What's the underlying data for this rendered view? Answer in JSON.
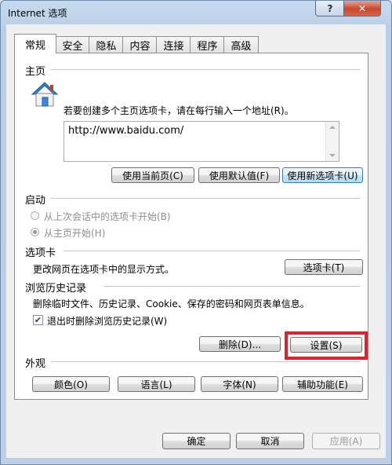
{
  "window": {
    "title": "Internet 选项",
    "help_label": "?",
    "close_label": "✕"
  },
  "tabs": [
    {
      "label": "常规",
      "active": true
    },
    {
      "label": "安全"
    },
    {
      "label": "隐私"
    },
    {
      "label": "内容"
    },
    {
      "label": "连接"
    },
    {
      "label": "程序"
    },
    {
      "label": "高级"
    }
  ],
  "home": {
    "title": "主页",
    "icon": "home-icon",
    "description": "若要创建多个主页选项卡，请在每行输入一个地址(R)。",
    "url": "http://www.baidu.com/",
    "use_current": "使用当前页(C)",
    "use_default": "使用默认值(F)",
    "use_new_tab": "使用新选项卡(U)"
  },
  "startup": {
    "title": "启动",
    "option_last_session": "从上次会话中的选项卡开始(B)",
    "option_home": "从主页开始(H)"
  },
  "tabs_section": {
    "title": "选项卡",
    "description": "更改网页在选项卡中的显示方式。",
    "button": "选项卡(T)"
  },
  "history": {
    "title": "浏览历史记录",
    "description": "删除临时文件、历史记录、Cookie、保存的密码和网页表单信息。",
    "checkbox_label": "退出时删除浏览历史记录(W)",
    "checkbox_checked": true,
    "delete_button": "删除(D)...",
    "settings_button": "设置(S)"
  },
  "appearance": {
    "title": "外观",
    "colors": "颜色(O)",
    "languages": "语言(L)",
    "fonts": "字体(N)",
    "accessibility": "辅助功能(E)"
  },
  "footer": {
    "ok": "确定",
    "cancel": "取消",
    "apply": "应用(A)"
  },
  "colors": {
    "highlight": "#e1222a"
  }
}
